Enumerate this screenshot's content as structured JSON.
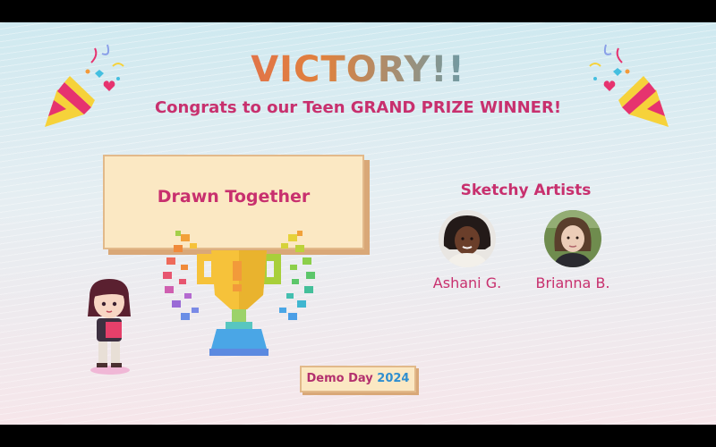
{
  "slide": {
    "title": "VICTORY!!",
    "subtitle": "Congrats to our Teen GRAND PRIZE WINNER!",
    "project": {
      "name": "Drawn Together"
    },
    "team": {
      "name": "Sketchy Artists",
      "members": [
        {
          "name": "Ashani G.",
          "avatar_icon": "person-photo"
        },
        {
          "name": "Brianna B.",
          "avatar_icon": "person-photo"
        }
      ]
    },
    "badge": {
      "label": "Demo Day",
      "year": "2024"
    }
  },
  "colors": {
    "accent_pink": "#c8306e",
    "card_fill": "#fbe8c3",
    "card_border": "#e2b98a",
    "year_blue": "#2f8fd0"
  },
  "icons": [
    "party-popper-icon",
    "trophy-icon",
    "laurel-wreath-icon",
    "cartoon-artist-icon",
    "confetti-icon"
  ]
}
